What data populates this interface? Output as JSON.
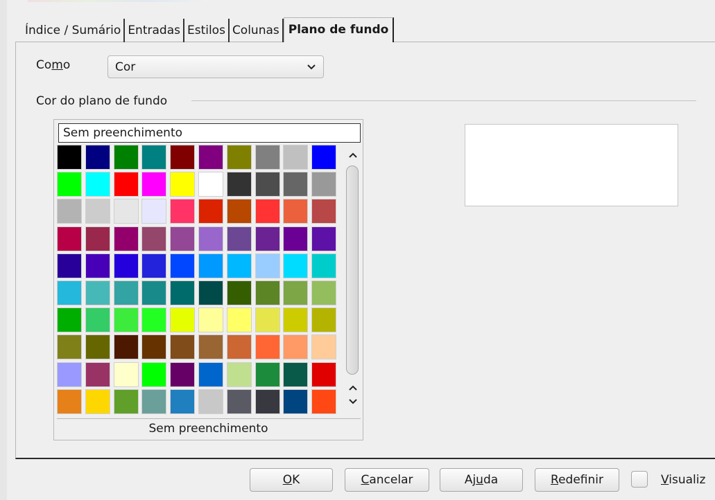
{
  "tabs": [
    {
      "label": "Índice / Sumário"
    },
    {
      "label": "Entradas"
    },
    {
      "label": "Estilos"
    },
    {
      "label": "Colunas"
    },
    {
      "label": "Plano de fundo",
      "active": true
    }
  ],
  "como": {
    "label_pre": "Co",
    "label_ul": "m",
    "label_post": "o",
    "selected": "Cor"
  },
  "section": {
    "label": "Cor do plano de fundo"
  },
  "palette": {
    "selected_name": "Sem preenchimento",
    "footer_label": "Sem preenchimento",
    "colors": [
      "#000000",
      "#000080",
      "#008000",
      "#008080",
      "#800000",
      "#800080",
      "#808000",
      "#808080",
      "#c0c0c0",
      "#0000ff",
      "#00ff00",
      "#00ffff",
      "#ff0000",
      "#ff00ff",
      "#ffff00",
      "#ffffff",
      "#333333",
      "#4d4d4d",
      "#666666",
      "#999999",
      "#b3b3b3",
      "#cccccc",
      "#e6e6e6",
      "#e6e6ff",
      "#ff3366",
      "#dc2300",
      "#b84700",
      "#ff3333",
      "#eb613d",
      "#b84747",
      "#b80047",
      "#99284c",
      "#94006b",
      "#94476b",
      "#944794",
      "#9966cc",
      "#6b4794",
      "#6b2394",
      "#6b0094",
      "#5e11a6",
      "#280099",
      "#4700b8",
      "#2300dc",
      "#2323dc",
      "#0047ff",
      "#0099ff",
      "#00b8ff",
      "#99ccff",
      "#00dcff",
      "#00cccc",
      "#23b8dc",
      "#47b8b8",
      "#33a3a3",
      "#198a8a",
      "#006b6b",
      "#004a4a",
      "#355e00",
      "#5c8526",
      "#7da647",
      "#94bd5e",
      "#00ae00",
      "#33cc66",
      "#3deb3d",
      "#23ff23",
      "#e6ff00",
      "#ffff99",
      "#ffff66",
      "#e6e64c",
      "#cccc00",
      "#b3b300",
      "#808019",
      "#666600",
      "#4c1900",
      "#663300",
      "#804c19",
      "#996633",
      "#cc6633",
      "#ff6633",
      "#ff9966",
      "#ffcc99",
      "#9999ff",
      "#993366",
      "#ffffcc",
      "#00ff00",
      "#660066",
      "#0066cc",
      "#c0e090",
      "#1c8c3c",
      "#0a5a4a",
      "#e00000",
      "#e68019",
      "#ffd700",
      "#5f9f2a",
      "#6a9f9a",
      "#1f7fbf",
      "#c8c8c8",
      "#5a5a64",
      "#383840",
      "#004480",
      "#ff4814"
    ]
  },
  "buttons": {
    "ok": {
      "pre": "",
      "ul": "O",
      "post": "K"
    },
    "cancel": {
      "pre": "",
      "ul": "C",
      "post": "ancelar"
    },
    "help": {
      "pre": "Aj",
      "ul": "u",
      "post": "da"
    },
    "reset": {
      "pre": "",
      "ul": "R",
      "post": "edefinir"
    },
    "preview": {
      "pre": "",
      "ul": "V",
      "post": "isualiz"
    }
  },
  "icons": {
    "dropdown": "chevron-down",
    "scroll_up": "chevron-up",
    "scroll_down": "chevron-down"
  }
}
